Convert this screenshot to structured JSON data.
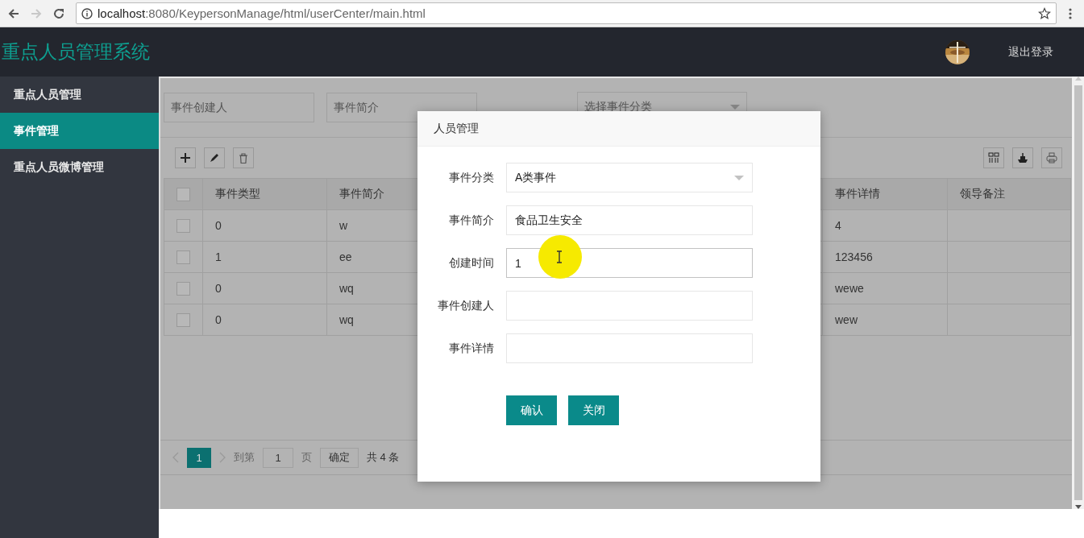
{
  "browser": {
    "url_host": "localhost",
    "url_path": ":8080/KeypersonManage/html/userCenter/main.html"
  },
  "header": {
    "title": "重点人员管理系统",
    "logout": "退出登录"
  },
  "sidebar": {
    "items": [
      {
        "label": "重点人员管理",
        "selected": false
      },
      {
        "label": "事件管理",
        "selected": true
      },
      {
        "label": "重点人员微博管理",
        "selected": false
      }
    ]
  },
  "filters": [
    {
      "kind": "text",
      "placeholder": "事件创建人"
    },
    {
      "kind": "text",
      "placeholder": "事件简介"
    },
    {
      "kind": "select",
      "placeholder": "选择事件分类"
    }
  ],
  "table": {
    "select_all_checked": false,
    "columns": [
      "事件类型",
      "事件简介",
      "事件详情",
      "领导备注"
    ],
    "rows": [
      {
        "checked": false,
        "cells": [
          "0",
          "w",
          "4"
        ]
      },
      {
        "checked": false,
        "cells": [
          "1",
          "ee",
          "123456"
        ]
      },
      {
        "checked": false,
        "cells": [
          "0",
          "wq",
          "wewe"
        ]
      },
      {
        "checked": false,
        "cells": [
          "0",
          "wq",
          "wew"
        ]
      }
    ]
  },
  "pagination": {
    "pages": [
      {
        "label": "1",
        "selected": true
      }
    ],
    "goto_label": "到第",
    "goto_value": "1",
    "page_unit": "页",
    "confirm": "确定",
    "total": "共 4 条"
  },
  "modal": {
    "title": "人员管理",
    "fields": [
      {
        "kind": "select",
        "label": "事件分类",
        "value": "A类事件",
        "focused": false
      },
      {
        "kind": "text",
        "label": "事件简介",
        "value": "食品卫生安全",
        "focused": false
      },
      {
        "kind": "text",
        "label": "创建时间",
        "value": "1",
        "focused": true
      },
      {
        "kind": "text",
        "label": "事件创建人",
        "focused": false
      },
      {
        "kind": "text",
        "label": "事件详情",
        "focused": false
      }
    ],
    "buttons": [
      "确认",
      "关闭"
    ]
  }
}
